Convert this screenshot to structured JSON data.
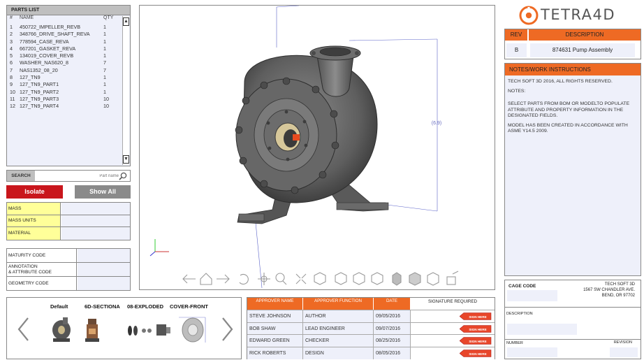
{
  "parts_list": {
    "title": "PARTS LIST",
    "col_num": "#",
    "col_name": "NAME",
    "col_qty": "QTY",
    "rows": [
      {
        "num": "1",
        "name": "450722_IMPELLER_REVB",
        "qty": "1"
      },
      {
        "num": "2",
        "name": "348766_DRIVE_SHAFT_REVA",
        "qty": "1"
      },
      {
        "num": "3",
        "name": "778594_CASE_REVA",
        "qty": "1"
      },
      {
        "num": "4",
        "name": "667201_GASKET_REVA",
        "qty": "1"
      },
      {
        "num": "5",
        "name": "134019_COVER_REVB",
        "qty": "1"
      },
      {
        "num": "6",
        "name": "WASHER_NAS620_8",
        "qty": "7"
      },
      {
        "num": "7",
        "name": "NAS1352_08_20",
        "qty": "7"
      },
      {
        "num": "8",
        "name": "127_TN9",
        "qty": "1"
      },
      {
        "num": "9",
        "name": "127_TN9_PART1",
        "qty": "1"
      },
      {
        "num": "10",
        "name": "127_TN9_PART2",
        "qty": "1"
      },
      {
        "num": "11",
        "name": "127_TN9_PART3",
        "qty": "10"
      },
      {
        "num": "12",
        "name": "127_TN9_PART4",
        "qty": "10"
      }
    ],
    "scroll_up": "▲",
    "scroll_down": "▼"
  },
  "search": {
    "label": "SEARCH",
    "placeholder": "Part name"
  },
  "buttons": {
    "isolate": "Isolate",
    "show_all": "Show All"
  },
  "properties": {
    "mass": "MASS",
    "mass_units": "MASS UNITS",
    "material": "MATERIAL"
  },
  "codes": {
    "maturity": "MATURITY CODE",
    "annotation_line1": "ANNOTATION",
    "annotation_line2": "& ATTRIBUTE CODE",
    "geometry": "GEOMETRY CODE"
  },
  "viewport": {
    "dimension_label": "(6.9)"
  },
  "views": {
    "items": [
      "Default",
      "6D-SECTIONA",
      "08-EXPLODED",
      "COVER-FRONT"
    ],
    "prev": "‹",
    "next": "›"
  },
  "approvals": {
    "headers": {
      "name": "APPROVER NAME",
      "function": "APPROVER FUNCTION",
      "date": "DATE",
      "signature": "SIGNATURE REQUIRED"
    },
    "sign_label": "SIGN HERE",
    "rows": [
      {
        "name": "STEVE JOHNSON",
        "function": "AUTHOR",
        "date": "09/05/2016"
      },
      {
        "name": "BOB SHAW",
        "function": "LEAD ENGINEER",
        "date": "09/07/2016"
      },
      {
        "name": "EDWARD GREEN",
        "function": "CHECKER",
        "date": "08/25/2016"
      },
      {
        "name": "RICK ROBERTS",
        "function": "DESIGN",
        "date": "08/05/2016"
      }
    ]
  },
  "logo": {
    "text": "TETRA4D"
  },
  "revision": {
    "rev_label": "REV",
    "desc_label": "DESCRIPTION",
    "rev_value": "B",
    "desc_value": "874631 Pump Assembly"
  },
  "notes": {
    "title": "NOTES/WORK INSTRUCTIONS",
    "p1": "TECH SOFT 3D 2016, ALL RIGHTS RESERVED.",
    "p2": "NOTES:",
    "p3": "SELECT PARTS  FROM BOM OR MODELTO POPULATE ATTRIBUTE AND PROPERTY INFORMATION IN THE DESIGNATED FIELDS.",
    "p4": "MODEL HAS BEEN CREATED IN ACCORDANCE WITH ASME Y14.5 2009."
  },
  "cage": {
    "label": "CAGE CODE",
    "company": "TECH SOFT 3D",
    "address1": "1567 SW CHANDLER AVE.",
    "address2": "BEND, OR 97702",
    "description": "DESCRIPTION",
    "number": "NUMBER",
    "revision": "REVISION"
  },
  "colors": {
    "accent": "#ee6a24",
    "isolate": "#c9161c",
    "show_all": "#8a8a8a",
    "field": "#eef0fa",
    "yellow": "#ffff99"
  }
}
